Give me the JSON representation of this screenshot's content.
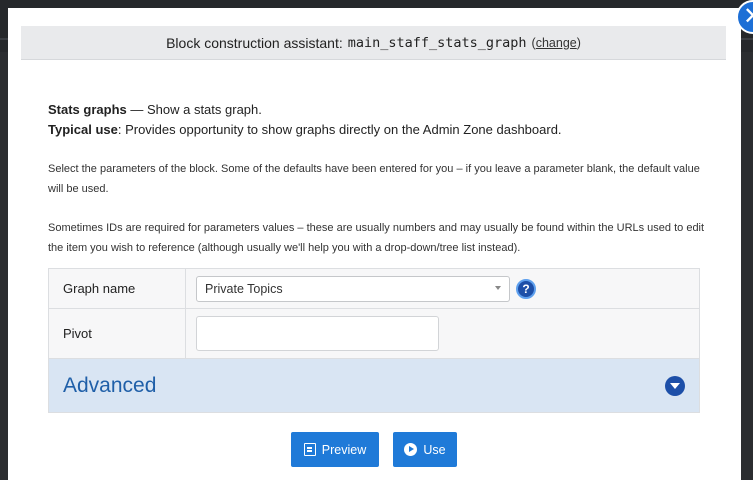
{
  "dialog": {
    "title_prefix": "Block construction assistant:",
    "block_code": "main_staff_stats_graph",
    "change_link": "change",
    "close_symbol": "✕"
  },
  "intro": {
    "block_name": "Stats graphs",
    "block_desc": " — Show a stats graph.",
    "typical_label": "Typical use",
    "typical_text": ": Provides opportunity to show graphs directly on the Admin Zone dashboard."
  },
  "help_paragraphs": [
    "Select the parameters of the block. Some of the defaults have been entered for you – if you leave a parameter blank, the default value will be used.",
    "Sometimes IDs are required for parameters values – these are usually numbers and may usually be found within the URLs used to edit the item you wish to reference (although usually we'll help you with a drop-down/tree list instead)."
  ],
  "params": {
    "graph_name": {
      "label": "Graph name",
      "selected": "Private Topics",
      "help_symbol": "?"
    },
    "pivot": {
      "label": "Pivot",
      "value": ""
    }
  },
  "advanced": {
    "label": "Advanced",
    "toggle_icon": "chevron-down-circle-icon"
  },
  "buttons": {
    "preview": {
      "label": "Preview",
      "icon": "preview-icon"
    },
    "use": {
      "label": "Use",
      "icon": "play-circle-icon"
    }
  },
  "colors": {
    "accent": "#1f7ad8",
    "advanced_bg": "#d9e5f3",
    "advanced_text": "#1f5fa8"
  }
}
